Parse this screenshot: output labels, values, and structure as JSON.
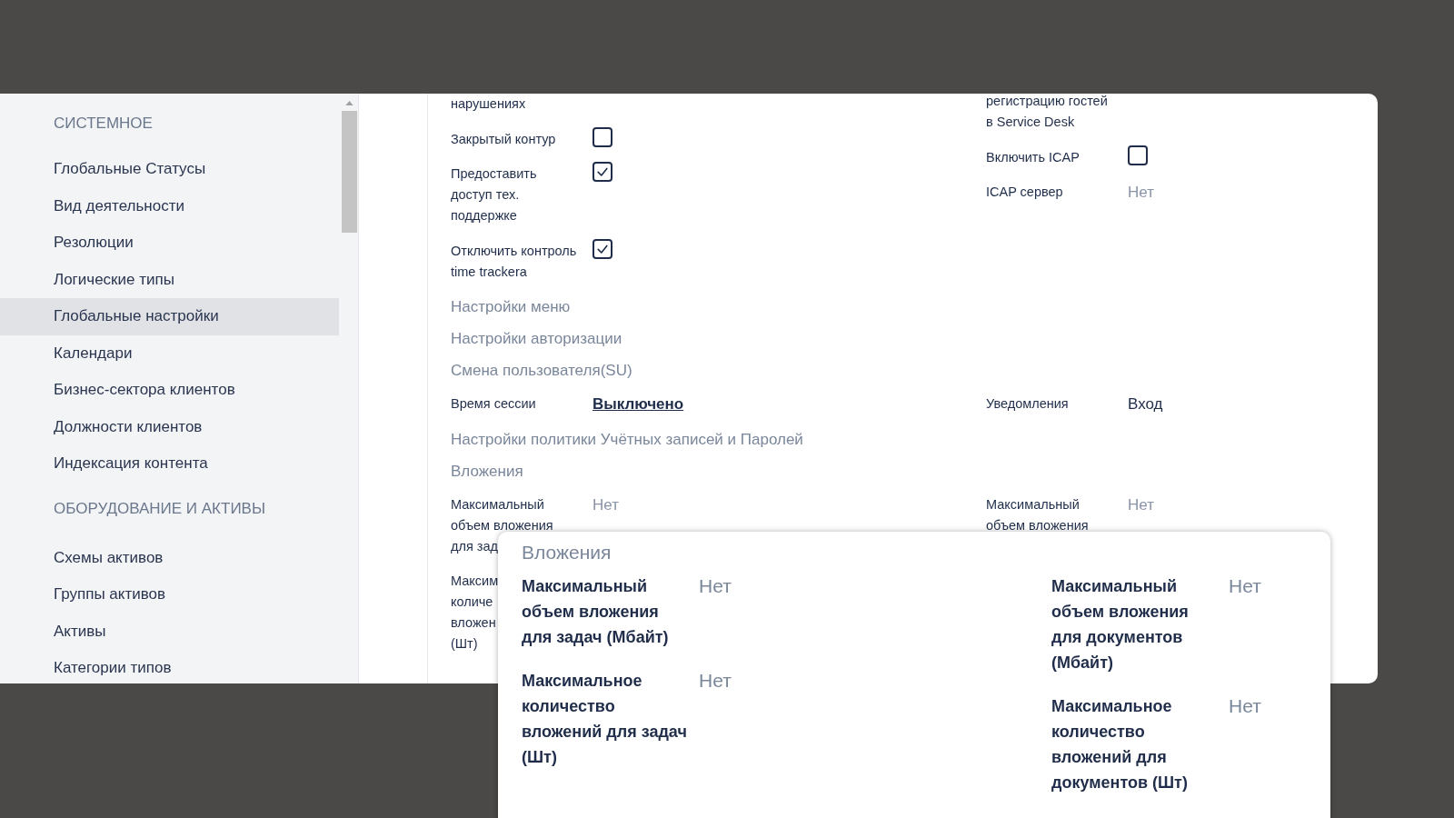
{
  "sidebar": {
    "groups": [
      {
        "title": "СИСТЕМНОЕ",
        "items": [
          {
            "label": "Глобальные Статусы",
            "selected": false
          },
          {
            "label": "Вид деятельности",
            "selected": false
          },
          {
            "label": "Резолюции",
            "selected": false
          },
          {
            "label": "Логические типы",
            "selected": false
          },
          {
            "label": "Глобальные настройки",
            "selected": true
          },
          {
            "label": "Календари",
            "selected": false
          },
          {
            "label": "Бизнес-сектора клиентов",
            "selected": false
          },
          {
            "label": "Должности клиентов",
            "selected": false
          },
          {
            "label": "Индексация контента",
            "selected": false
          }
        ]
      },
      {
        "title": "ОБОРУДОВАНИЕ И АКТИВЫ",
        "items": [
          {
            "label": "Схемы активов",
            "selected": false
          },
          {
            "label": "Группы активов",
            "selected": false
          },
          {
            "label": "Активы",
            "selected": false
          },
          {
            "label": "Категории типов",
            "selected": false
          }
        ]
      }
    ]
  },
  "settings": {
    "rows": [
      {
        "kind": "fields",
        "left": [
          {
            "kind": "label",
            "lines": [
              "нарушениях"
            ]
          },
          {
            "kind": "checkbox",
            "lines": [
              "Закрытый контур"
            ],
            "checked": false
          },
          {
            "kind": "checkbox",
            "lines": [
              "Предоставить",
              "доступ тех.",
              "поддержке"
            ],
            "checked": true
          },
          {
            "kind": "checkbox",
            "lines": [
              "Отключить контроль",
              "time trackera"
            ],
            "checked": true
          }
        ],
        "right": [
          {
            "kind": "label",
            "lines": [
              "регистрацию гостей",
              "в Service Desk"
            ]
          },
          {
            "kind": "checkbox",
            "lines": [
              "Включить ICAP"
            ],
            "checked": false
          },
          {
            "kind": "value",
            "lines": [
              "ICAP сервер"
            ],
            "value": "Нет"
          }
        ]
      },
      {
        "kind": "heading",
        "text": "Настройки меню"
      },
      {
        "kind": "heading",
        "text": "Настройки авторизации"
      },
      {
        "kind": "heading",
        "text": "Смена пользователя(SU)"
      },
      {
        "kind": "fields",
        "left": [
          {
            "kind": "link",
            "lines": [
              "Время сессии"
            ],
            "value": "Выключено"
          }
        ],
        "right": [
          {
            "kind": "text",
            "lines": [
              "Уведомления"
            ],
            "value": "Вход"
          }
        ]
      },
      {
        "kind": "heading",
        "text": "Настройки политики Учётных записей и Паролей"
      },
      {
        "kind": "heading",
        "text": "Вложения"
      },
      {
        "kind": "fields",
        "left": [
          {
            "kind": "value",
            "lines": [
              "Максимальный",
              "объем вложения",
              "для зад"
            ],
            "value": "Нет"
          },
          {
            "kind": "label",
            "lines": [
              "Максим",
              "количе",
              "вложен",
              "(Шт)"
            ]
          }
        ],
        "right": [
          {
            "kind": "value",
            "lines": [
              "Максимальный",
              "объем вложения"
            ],
            "value": "Нет"
          }
        ]
      }
    ]
  },
  "popup": {
    "title": "Вложения",
    "columns": [
      [
        {
          "lines": [
            "Максимальный",
            "объем вложения",
            "для задач (Мбайт)"
          ],
          "value": "Нет"
        },
        {
          "lines": [
            "Максимальное",
            "количество",
            "вложений для задач",
            "(Шт)"
          ],
          "value": "Нет"
        }
      ],
      [
        {
          "lines": [
            "Максимальный",
            "объем вложения",
            "для документов",
            "(Мбайт)"
          ],
          "value": "Нет"
        },
        {
          "lines": [
            "Максимальное",
            "количество",
            "вложений для",
            "документов (Шт)"
          ],
          "value": "Нет"
        }
      ]
    ]
  }
}
